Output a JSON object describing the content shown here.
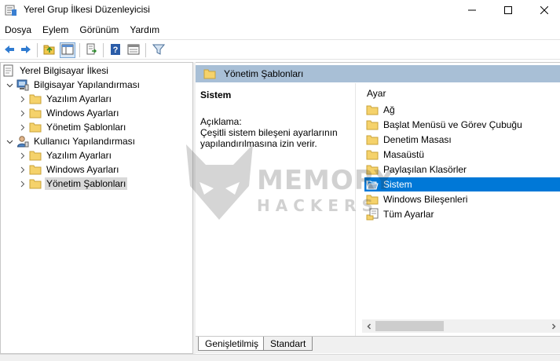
{
  "window": {
    "title": "Yerel Grup İlkesi Düzenleyicisi",
    "app_icon": "policy-editor-icon"
  },
  "menu": [
    "Dosya",
    "Eylem",
    "Görünüm",
    "Yardım"
  ],
  "toolbar": {
    "icons": [
      "back-icon",
      "forward-icon",
      "up-folder-icon",
      "show-hide-tree-icon",
      "export-list-icon",
      "help-icon",
      "properties-icon",
      "filter-icon"
    ]
  },
  "tree": {
    "root": "Yerel Bilgisayar İlkesi",
    "computer_config": "Bilgisayar Yapılandırması",
    "computer_children": [
      "Yazılım Ayarları",
      "Windows Ayarları",
      "Yönetim Şablonları"
    ],
    "user_config": "Kullanıcı Yapılandırması",
    "user_children": [
      "Yazılım Ayarları",
      "Windows Ayarları",
      "Yönetim Şablonları"
    ],
    "selected": "Yönetim Şablonları"
  },
  "detail": {
    "header": "Yönetim Şablonları",
    "title": "Sistem",
    "desc_label": "Açıklama:",
    "desc_text": "Çeşitli sistem bileşeni ayarlarının yapılandırılmasına izin verir."
  },
  "list": {
    "column": "Ayar",
    "items": [
      "Ağ",
      "Başlat Menüsü ve Görev Çubuğu",
      "Denetim Masası",
      "Masaüstü",
      "Paylaşılan Klasörler",
      "Sistem",
      "Windows Bileşenleri",
      "Tüm Ayarlar"
    ],
    "selected": "Sistem"
  },
  "tabs": [
    "Genişletilmiş",
    "Standart"
  ],
  "watermark": {
    "line1": "MEMORY",
    "line2": "HACKERS"
  },
  "colors": {
    "selection": "#0078d7",
    "header_bg": "#a8bfd6",
    "folder": "#f2c94c"
  }
}
